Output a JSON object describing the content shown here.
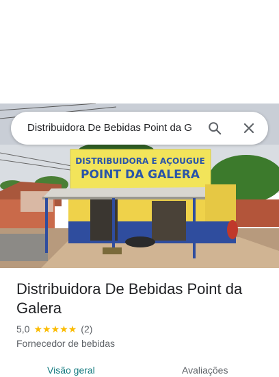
{
  "search": {
    "query": "Distribuidora De Bebidas Point da G"
  },
  "photo": {
    "sign_line1": "DISTRIBUIDORA E AÇOUGUE",
    "sign_line2": "POINT DA GALERA"
  },
  "place": {
    "title": "Distribuidora De Bebidas Point da Galera",
    "rating": "5,0",
    "stars": 5,
    "review_count": "(2)",
    "category": "Fornecedor de bebidas"
  },
  "tabs": [
    {
      "label": "Visão geral"
    },
    {
      "label": "Avaliações"
    }
  ],
  "colors": {
    "star": "#fbbc04",
    "active_tab": "#137a7f"
  }
}
